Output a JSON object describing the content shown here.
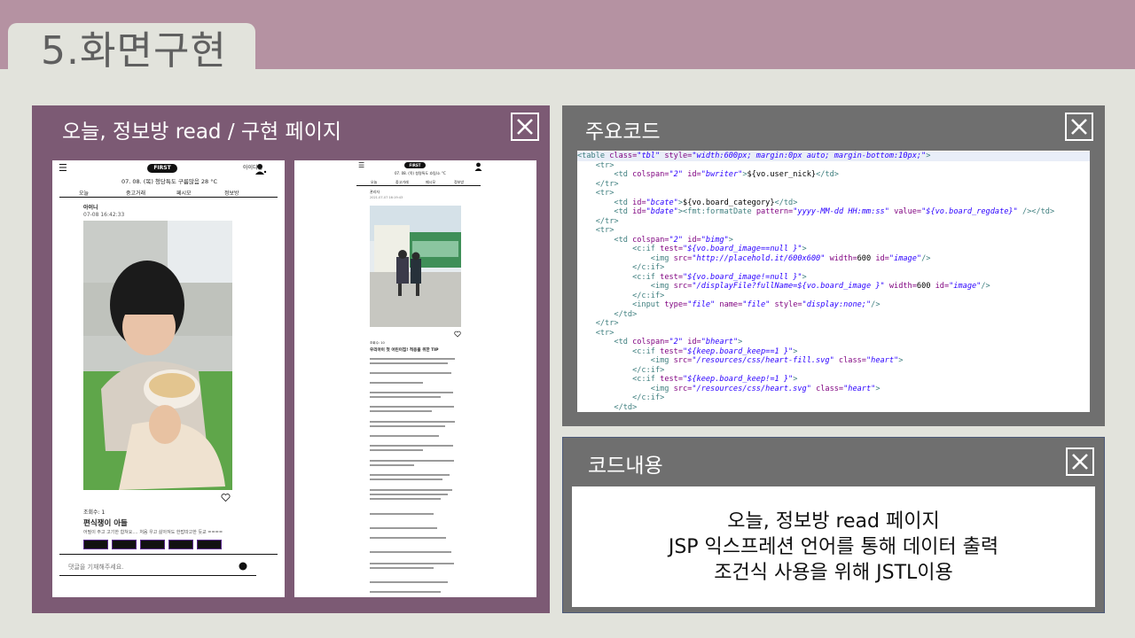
{
  "slide": {
    "title": "5.화면구현"
  },
  "left_panel": {
    "title": "오늘, 정보방 read / 구현 페이지",
    "phone1": {
      "date_weather": "07. 08. (목)  청당특도 구름많음 28 °C",
      "user": "아이디님",
      "tabs": [
        "오늘",
        "중고거래",
        "페시모",
        "정보방"
      ],
      "author": "아이니",
      "timestamp": "07-08 16:42:33",
      "views": "조회수: 1",
      "post_title": "편식쟁이 아들",
      "post_body": "어필이 주고 고기한 합쳐요.... 처음 우고 삶아져도 한밥따고한 듯교 ====",
      "comment_placeholder": "댓글을 기재해주세요."
    },
    "phone2": {
      "date_weather": "07. 08. (목) 청명특도 흐림/소 °C",
      "tabs": [
        "오늘",
        "중고거래",
        "페시모",
        "정보방"
      ],
      "author": "관리자",
      "timestamp": "2021-07-07 16:19:43",
      "views": "조회수: 10",
      "post_title": "우리아이 첫 어린이집! 적응을 위한 TIP"
    }
  },
  "code_panel": {
    "title": "주요코드",
    "lines": [
      [
        [
          "t",
          "<table "
        ],
        [
          "a",
          "class="
        ],
        [
          "v",
          "\"tbl\""
        ],
        [
          "a",
          " style="
        ],
        [
          "v",
          "\"width:600px; margin:0px auto; margin-bottom:10px;\""
        ],
        [
          "t",
          ">"
        ]
      ],
      [
        [
          "t",
          "    <tr>"
        ]
      ],
      [
        [
          "t",
          "        <td "
        ],
        [
          "a",
          "colspan="
        ],
        [
          "v",
          "\"2\""
        ],
        [
          "a",
          " id="
        ],
        [
          "v",
          "\"bwriter\""
        ],
        [
          "t",
          ">"
        ],
        [
          "x",
          "${vo.user_nick}"
        ],
        [
          "t",
          "</td>"
        ]
      ],
      [
        [
          "t",
          "    </tr>"
        ]
      ],
      [
        [
          "t",
          "    <tr>"
        ]
      ],
      [
        [
          "t",
          "        <td "
        ],
        [
          "a",
          "id="
        ],
        [
          "v",
          "\"bcate\""
        ],
        [
          "t",
          ">"
        ],
        [
          "x",
          "${vo.board_category}"
        ],
        [
          "t",
          "</td>"
        ]
      ],
      [
        [
          "t",
          "        <td "
        ],
        [
          "a",
          "id="
        ],
        [
          "v",
          "\"bdate\""
        ],
        [
          "t",
          ">"
        ],
        [
          "t",
          "<fmt:formatDate "
        ],
        [
          "a",
          "pattern="
        ],
        [
          "v",
          "\"yyyy-MM-dd HH:mm:ss\""
        ],
        [
          "a",
          " value="
        ],
        [
          "v",
          "\"${vo.board_regdate}\""
        ],
        [
          "t",
          " /></td>"
        ]
      ],
      [
        [
          "t",
          "    </tr>"
        ]
      ],
      [
        [
          "t",
          "    <tr>"
        ]
      ],
      [
        [
          "t",
          "        <td "
        ],
        [
          "a",
          "colspan="
        ],
        [
          "v",
          "\"2\""
        ],
        [
          "a",
          " id="
        ],
        [
          "v",
          "\"bimg\""
        ],
        [
          "t",
          ">"
        ]
      ],
      [
        [
          "t",
          "            <c:if "
        ],
        [
          "a",
          "test="
        ],
        [
          "v",
          "\"${vo.board_image==null }\""
        ],
        [
          "t",
          ">"
        ]
      ],
      [
        [
          "t",
          "                <img "
        ],
        [
          "a",
          "src="
        ],
        [
          "v",
          "\"http://placehold.it/600x600\""
        ],
        [
          "a",
          " width="
        ],
        [
          "x",
          "600"
        ],
        [
          "a",
          " id="
        ],
        [
          "v",
          "\"image\""
        ],
        [
          "t",
          "/>"
        ]
      ],
      [
        [
          "t",
          "            </c:if>"
        ]
      ],
      [
        [
          "t",
          "            <c:if "
        ],
        [
          "a",
          "test="
        ],
        [
          "v",
          "\"${vo.board_image!=null }\""
        ],
        [
          "t",
          ">"
        ]
      ],
      [
        [
          "t",
          "                <img "
        ],
        [
          "a",
          "src="
        ],
        [
          "v",
          "\"/displayFile?fullName=${vo.board_image }\""
        ],
        [
          "a",
          " width="
        ],
        [
          "x",
          "600"
        ],
        [
          "a",
          " id="
        ],
        [
          "v",
          "\"image\""
        ],
        [
          "t",
          "/>"
        ]
      ],
      [
        [
          "t",
          "            </c:if>"
        ]
      ],
      [
        [
          "t",
          "            <input "
        ],
        [
          "a",
          "type="
        ],
        [
          "v",
          "\"file\""
        ],
        [
          "a",
          " name="
        ],
        [
          "v",
          "\"file\""
        ],
        [
          "a",
          " style="
        ],
        [
          "v",
          "\"display:none;\""
        ],
        [
          "t",
          "/>"
        ]
      ],
      [
        [
          "t",
          "        </td>"
        ]
      ],
      [
        [
          "t",
          "    </tr>"
        ]
      ],
      [
        [
          "t",
          "    <tr>"
        ]
      ],
      [
        [
          "t",
          "        <td "
        ],
        [
          "a",
          "colspan="
        ],
        [
          "v",
          "\"2\""
        ],
        [
          "a",
          " id="
        ],
        [
          "v",
          "\"bheart\""
        ],
        [
          "t",
          ">"
        ]
      ],
      [
        [
          "t",
          "            <c:if "
        ],
        [
          "a",
          "test="
        ],
        [
          "v",
          "\"${keep.board_keep==1 }\""
        ],
        [
          "t",
          ">"
        ]
      ],
      [
        [
          "t",
          "                <img "
        ],
        [
          "a",
          "src="
        ],
        [
          "v",
          "\"/resources/css/heart-fill.svg\""
        ],
        [
          "a",
          " class="
        ],
        [
          "v",
          "\"heart\""
        ],
        [
          "t",
          ">"
        ]
      ],
      [
        [
          "t",
          "            </c:if>"
        ]
      ],
      [
        [
          "t",
          "            <c:if "
        ],
        [
          "a",
          "test="
        ],
        [
          "v",
          "\"${keep.board_keep!=1 }\""
        ],
        [
          "t",
          ">"
        ]
      ],
      [
        [
          "t",
          "                <img "
        ],
        [
          "a",
          "src="
        ],
        [
          "v",
          "\"/resources/css/heart.svg\""
        ],
        [
          "a",
          " class="
        ],
        [
          "v",
          "\"heart\""
        ],
        [
          "t",
          ">"
        ]
      ],
      [
        [
          "t",
          "            </c:if>"
        ]
      ],
      [
        [
          "t",
          "        </td>"
        ]
      ]
    ]
  },
  "content_panel": {
    "title": "코드내용",
    "lines": [
      "오늘, 정보방 read 페이지",
      "JSP 익스프레션 언어를 통해 데이터 출력",
      "조건식 사용을 위해 JSTL이용"
    ]
  },
  "colors": {
    "topbar": "#b592a2",
    "left_panel": "#7c5a74",
    "right_panels": "#6f6f6f",
    "background": "#e2e3dc"
  }
}
